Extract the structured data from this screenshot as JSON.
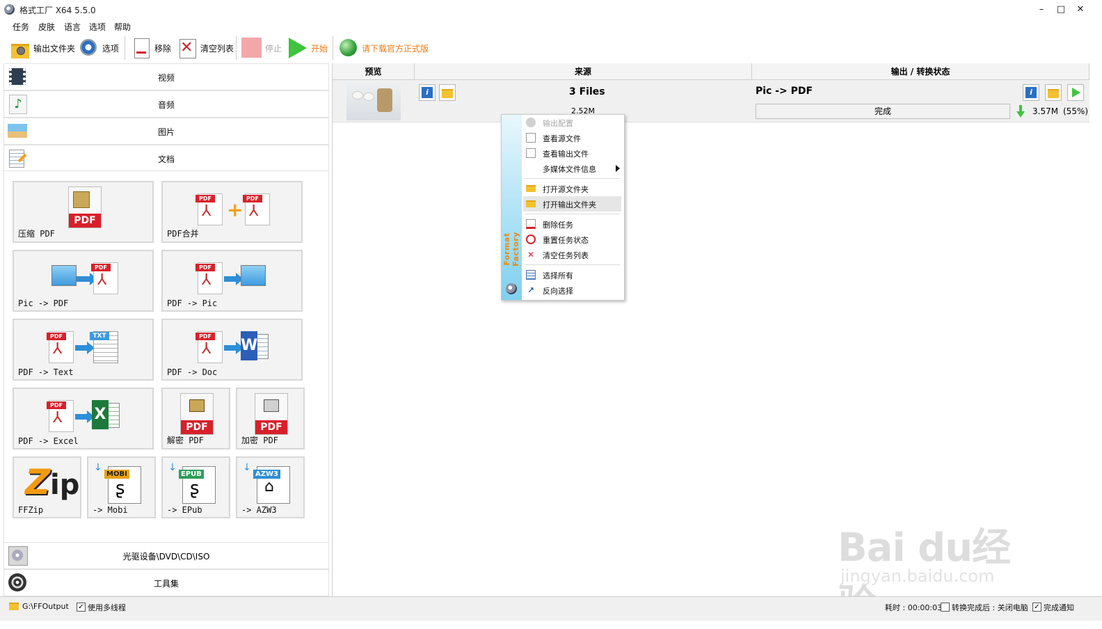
{
  "window": {
    "title": "格式工厂 X64 5.5.0",
    "minimize": "–",
    "maximize": "□",
    "close": "✕"
  },
  "menu": [
    "任务",
    "皮肤",
    "语言",
    "选项",
    "帮助"
  ],
  "toolbar": {
    "output_folder": "输出文件夹",
    "options": "选项",
    "remove": "移除",
    "clear_list": "清空列表",
    "stop": "停止",
    "start": "开始",
    "download": "请下载官方正式版",
    "download_color": "#f07a14"
  },
  "categories": {
    "video": "视频",
    "audio": "音频",
    "image": "图片",
    "document": "文档"
  },
  "tiles": {
    "compress_pdf": "压缩 PDF",
    "pdf_merge": "PDF合并",
    "pic_to_pdf": "Pic -> PDF",
    "pdf_to_pic": "PDF -> Pic",
    "pdf_to_text": "PDF -> Text",
    "pdf_to_doc": "PDF -> Doc",
    "pdf_to_excel": "PDF -> Excel",
    "decrypt_pdf": "解密 PDF",
    "encrypt_pdf": "加密 PDF",
    "ffzip": "FFZip",
    "to_mobi": "-> Mobi",
    "to_epub": "-> EPub",
    "to_azw3": "-> AZW3"
  },
  "tile_tags": {
    "pdf": "PDF",
    "txt": "TXT",
    "word": "W",
    "excel": "X",
    "mobi": "MOBI",
    "epub": "EPUB",
    "azw3": "AZW3"
  },
  "bottom_categories": {
    "disc": "光驱设备\\DVD\\CD\\ISO",
    "tools": "工具集"
  },
  "task_table": {
    "headers": {
      "preview": "预览",
      "source": "来源",
      "output": "输出 / 转换状态"
    },
    "row": {
      "files": "3 Files",
      "source_size": "2.52M",
      "conversion": "Pic -> PDF",
      "status": "完成",
      "output_size": "3.57M",
      "ratio": "(55%)"
    }
  },
  "context_menu": {
    "brand": "Format Factory",
    "items": [
      {
        "label": "输出配置",
        "disabled": true
      },
      {
        "label": "查看源文件"
      },
      {
        "label": "查看输出文件"
      },
      {
        "label": "多媒体文件信息",
        "submenu": true
      },
      {
        "label": "打开源文件夹"
      },
      {
        "label": "打开输出文件夹",
        "hover": true
      },
      {
        "label": "删除任务"
      },
      {
        "label": "重置任务状态"
      },
      {
        "label": "清空任务列表"
      },
      {
        "label": "选择所有"
      },
      {
        "label": "反向选择"
      }
    ]
  },
  "statusbar": {
    "output_path": "G:\\FFOutput",
    "multithread": "使用多线程",
    "elapsed": "耗时 : 00:00:03",
    "after_convert": "转换完成后 : 关闭电脑",
    "notify": "完成通知"
  },
  "watermark": {
    "logo": "Bai du经验",
    "url": "jingyan.baidu.com"
  },
  "colors": {
    "accent_green": "#3ec43e",
    "pdf_red": "#d8202a",
    "arrow_blue": "#2d8fd8",
    "brand_orange": "#e98a12"
  }
}
